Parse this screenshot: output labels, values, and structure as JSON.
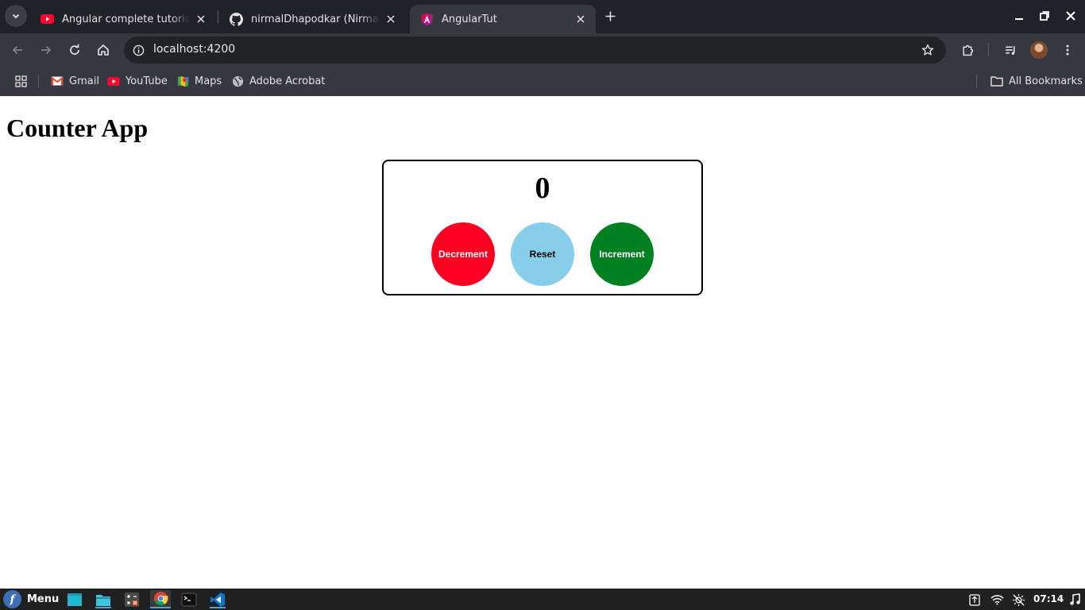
{
  "browser": {
    "tabs": [
      {
        "title": "Angular complete tutorial in Hindi",
        "favicon": "youtube-icon",
        "active": false
      },
      {
        "title": "nirmalDhapodkar (Nirmal Dhapodkar)",
        "favicon": "github-icon",
        "active": false
      },
      {
        "title": "AngularTut",
        "favicon": "angular-icon",
        "active": true
      }
    ],
    "address": {
      "url": "localhost:4200"
    },
    "bookmarks": [
      {
        "label": "Gmail",
        "icon": "gmail-icon"
      },
      {
        "label": "YouTube",
        "icon": "youtube-icon"
      },
      {
        "label": "Maps",
        "icon": "maps-icon"
      },
      {
        "label": "Adobe Acrobat",
        "icon": "globe-icon"
      }
    ],
    "all_bookmarks_label": "All Bookmarks"
  },
  "page": {
    "title": "Counter App",
    "count": "0",
    "buttons": {
      "decrement": "Decrement",
      "reset": "Reset",
      "increment": "Increment"
    }
  },
  "taskbar": {
    "menu_label": "Menu",
    "clock": "07:14",
    "apps": [
      "show-desktop",
      "files",
      "calculator",
      "chrome",
      "terminal",
      "vscode"
    ]
  },
  "colors": {
    "decrement": "#ff0022",
    "reset": "#87ceeb",
    "increment": "#008020",
    "chrome_dark": "#1f2329",
    "chrome_toolbar": "#35393f"
  }
}
